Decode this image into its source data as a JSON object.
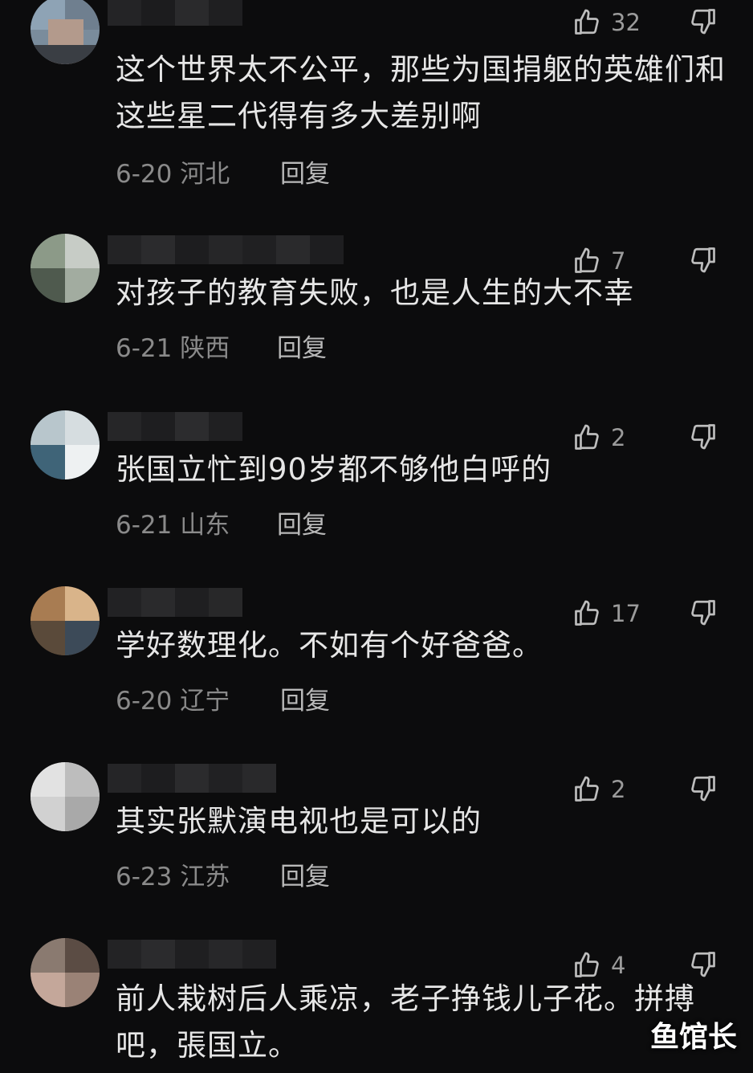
{
  "comments": [
    {
      "text": "这个世界太不公平，那些为国捐躯的英雄们和这些星二代得有多大差别啊",
      "date_region": "6-20 河北",
      "reply": "回复",
      "likes": "32"
    },
    {
      "text": "对孩子的教育失败，也是人生的大不幸",
      "date_region": "6-21 陕西",
      "reply": "回复",
      "likes": "7"
    },
    {
      "text": "张国立忙到90岁都不够他白呼的",
      "date_region": "6-21 山东",
      "reply": "回复",
      "likes": "2"
    },
    {
      "text": "学好数理化。不如有个好爸爸。",
      "date_region": "6-20 辽宁",
      "reply": "回复",
      "likes": "17"
    },
    {
      "text": "其实张默演电视也是可以的",
      "date_region": "6-23 江苏",
      "reply": "回复",
      "likes": "2"
    },
    {
      "text": "前人栽树后人乘凉，老子挣钱儿子花。拼搏吧，張国立。",
      "date_region": "",
      "reply": "",
      "likes": "4"
    }
  ],
  "watermark": "鱼馆长",
  "colors": {
    "background": "#0c0c0d",
    "text": "#e6e6e6",
    "meta": "#8a8a8a",
    "icon": "#bdbdbd"
  },
  "icons": {
    "like": "thumb-up-icon",
    "dislike": "thumb-down-icon"
  }
}
